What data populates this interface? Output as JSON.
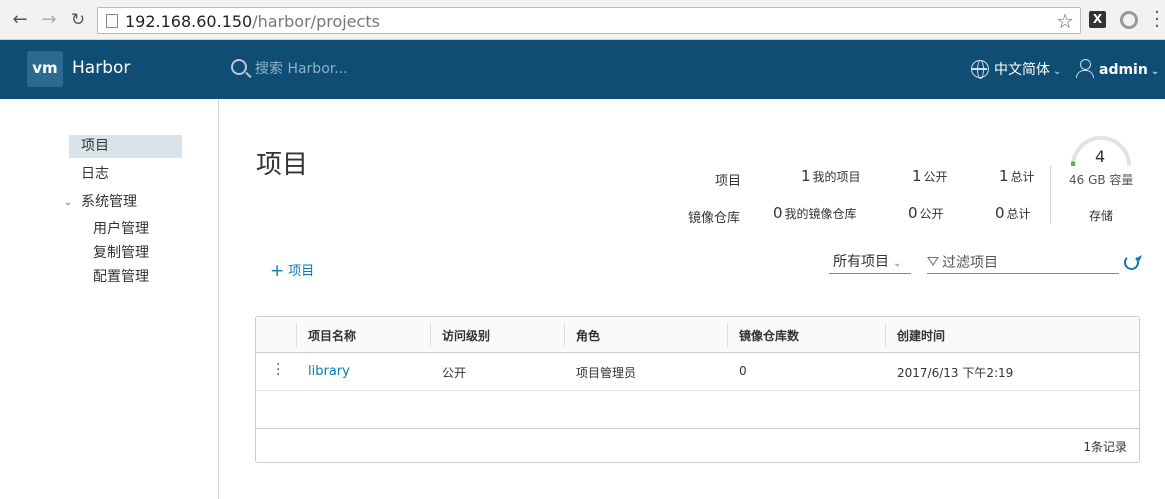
{
  "browser": {
    "url_host": "192.168.60.150",
    "url_path": "/harbor/projects"
  },
  "header": {
    "logo_text": "vm",
    "app_title": "Harbor",
    "search_placeholder": "搜索 Harbor...",
    "language": "中文简体",
    "user": "admin"
  },
  "sidebar": {
    "items": [
      {
        "label": "项目",
        "active": true
      },
      {
        "label": "日志",
        "active": false
      },
      {
        "label": "系统管理",
        "active": false
      }
    ],
    "sub_items": [
      "用户管理",
      "复制管理",
      "配置管理"
    ]
  },
  "main": {
    "title": "项目",
    "stats": {
      "projects_label": "项目",
      "repos_label": "镜像仓库",
      "my_projects_num": "1",
      "my_projects_label": "我的项目",
      "public_projects_num": "1",
      "public_label": "公开",
      "total_projects_num": "1",
      "total_label": "总计",
      "my_repos_num": "0",
      "my_repos_label": "我的镜像仓库",
      "public_repos_num": "0",
      "total_repos_num": "0"
    },
    "storage": {
      "count": "4",
      "capacity": "46 GB 容量",
      "label": "存储",
      "used_fraction": 0.05
    },
    "add_project_label": "项目",
    "filter_select": "所有项目",
    "filter_placeholder": "过滤项目",
    "table": {
      "columns": [
        "项目名称",
        "访问级别",
        "角色",
        "镜像仓库数",
        "创建时间"
      ],
      "rows": [
        {
          "name": "library",
          "access": "公开",
          "role": "项目管理员",
          "repos": "0",
          "created": "2017/6/13 下午2:19"
        }
      ],
      "footer": "1条记录"
    }
  },
  "colors": {
    "header_bg": "#0f4d75",
    "link": "#0a7bb5",
    "active_sidebar": "#d9e4ea",
    "gauge_fill": "#5bb346"
  }
}
